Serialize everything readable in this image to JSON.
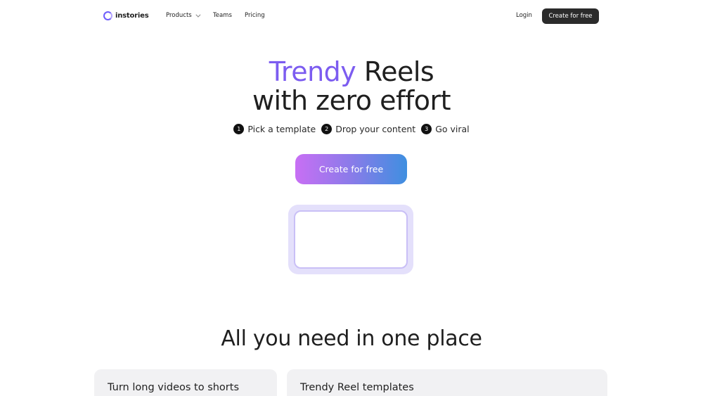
{
  "nav": {
    "logo_text": "instories",
    "logo_icon": "ring-logo-icon",
    "links": {
      "products": "Products",
      "teams": "Teams",
      "pricing": "Pricing",
      "login": "Login"
    },
    "cta": "Create for free"
  },
  "hero": {
    "title_accent": "Trendy",
    "title_rest": " Reels",
    "title_line2": "with zero effort",
    "steps": [
      {
        "num": "1",
        "label": "Pick a template"
      },
      {
        "num": "2",
        "label": "Drop your content"
      },
      {
        "num": "3",
        "label": "Go viral"
      }
    ],
    "cta": "Create for free"
  },
  "section": {
    "title": "All you need in one place",
    "cards": [
      {
        "title": "Turn long videos to shorts"
      },
      {
        "title": "Trendy Reel templates"
      }
    ]
  },
  "colors": {
    "accent": "#7c5cf0",
    "dark_button": "#2b2b2b",
    "gradient_start": "#c86ff4",
    "gradient_end": "#3f8fe0"
  }
}
